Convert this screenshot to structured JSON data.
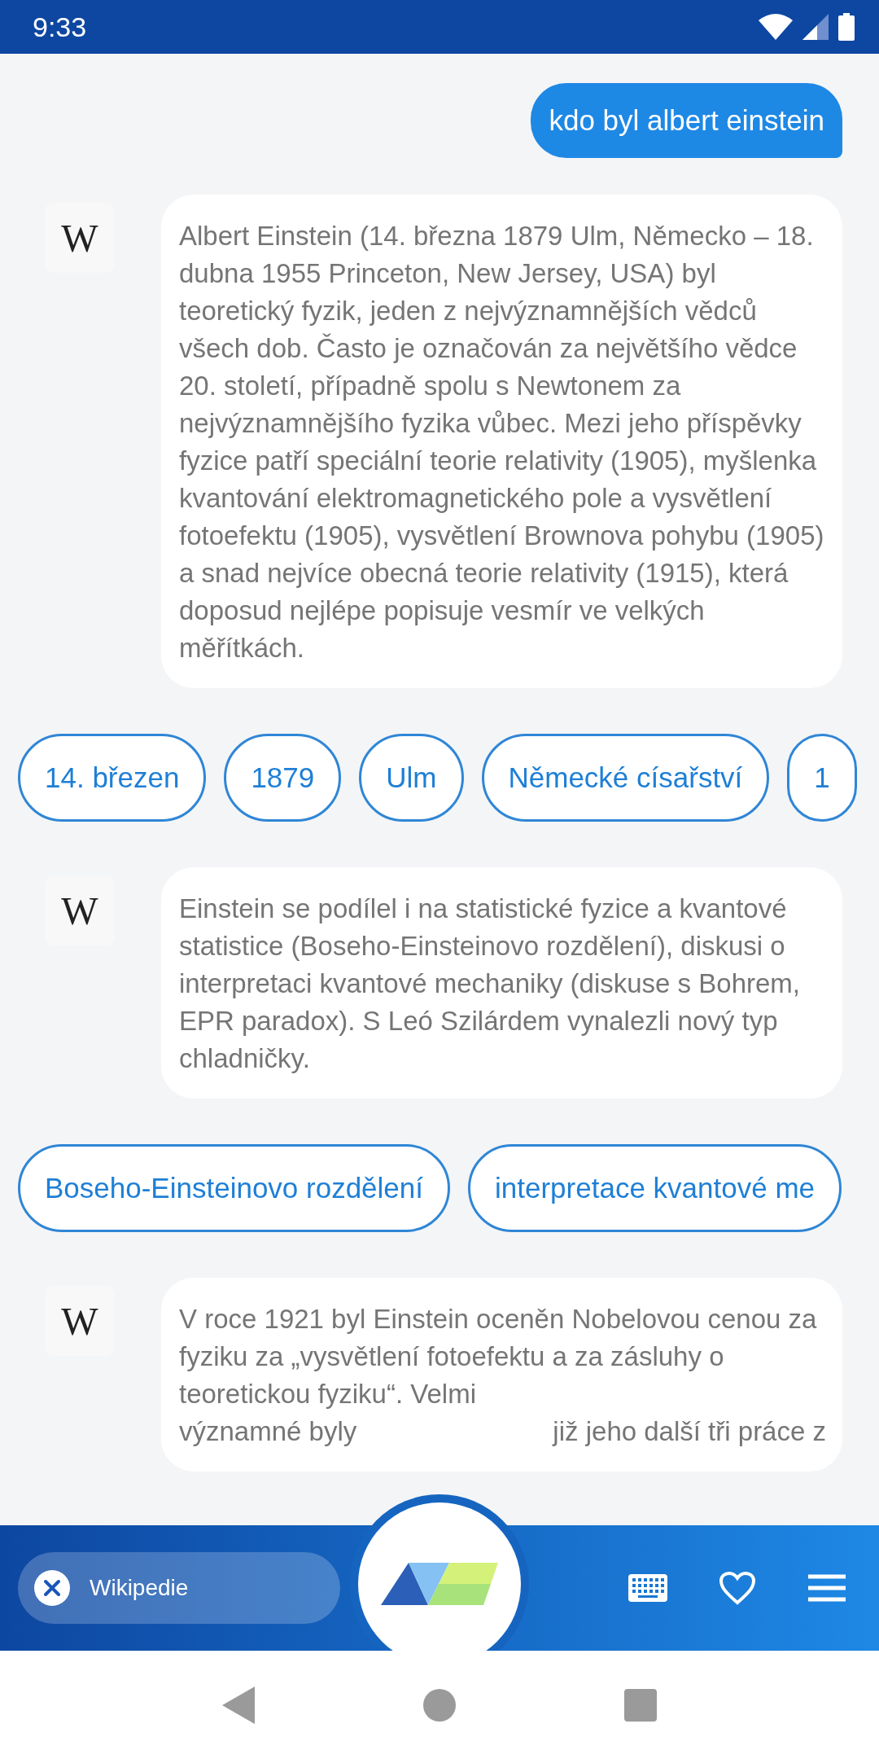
{
  "status_bar": {
    "time": "9:33"
  },
  "messages": [
    {
      "kind": "user",
      "text": "kdo byl albert einstein"
    },
    {
      "kind": "bot",
      "avatar": "W",
      "text": "Albert Einstein (14. března 1879 Ulm, Německo – 18. dubna 1955 Princeton, New Jersey, USA) byl teoretický fyzik, jeden z nejvýznamnějších vědců všech dob. Často je označován za největšího vědce 20. století, případně spolu s Newtonem za nejvýznamnějšího fyzika vůbec. Mezi jeho příspěvky fyzice patří speciální teorie relativity (1905), myšlenka kvantování elektromagnetického pole a vysvětlení fotoefektu (1905), vysvětlení Brownova pohybu (1905) a snad nejvíce obecná teorie relativity (1915), která doposud nejlépe popisuje vesmír ve velkých měřítkách."
    },
    {
      "kind": "chips",
      "chips": [
        "14. březen",
        "1879",
        "Ulm",
        "Německé císařství",
        "1"
      ]
    },
    {
      "kind": "bot",
      "avatar": "W",
      "text": "Einstein se podílel i na statistické fyzice a kvantové statistice (Boseho-Einsteinovo rozdělení), diskusi o interpretaci kvantové mechaniky (diskuse s Bohrem, EPR paradox). S Leó Szilárdem vynalezli nový typ chladničky."
    },
    {
      "kind": "chips",
      "chips": [
        "Boseho-Einsteinovo rozdělení",
        "interpretace kvantové me"
      ]
    },
    {
      "kind": "bot",
      "avatar": "W",
      "text": "V roce 1921 byl Einstein oceněn Nobelovou cenou za fyziku za „vysvětlení fotoefektu a za zásluhy o teoretickou fyziku“. Velmi",
      "partial_line": [
        "významné byly",
        "již jeho další tři práce z"
      ]
    }
  ],
  "bottom_bar": {
    "source_chip": "Wikipedie"
  }
}
